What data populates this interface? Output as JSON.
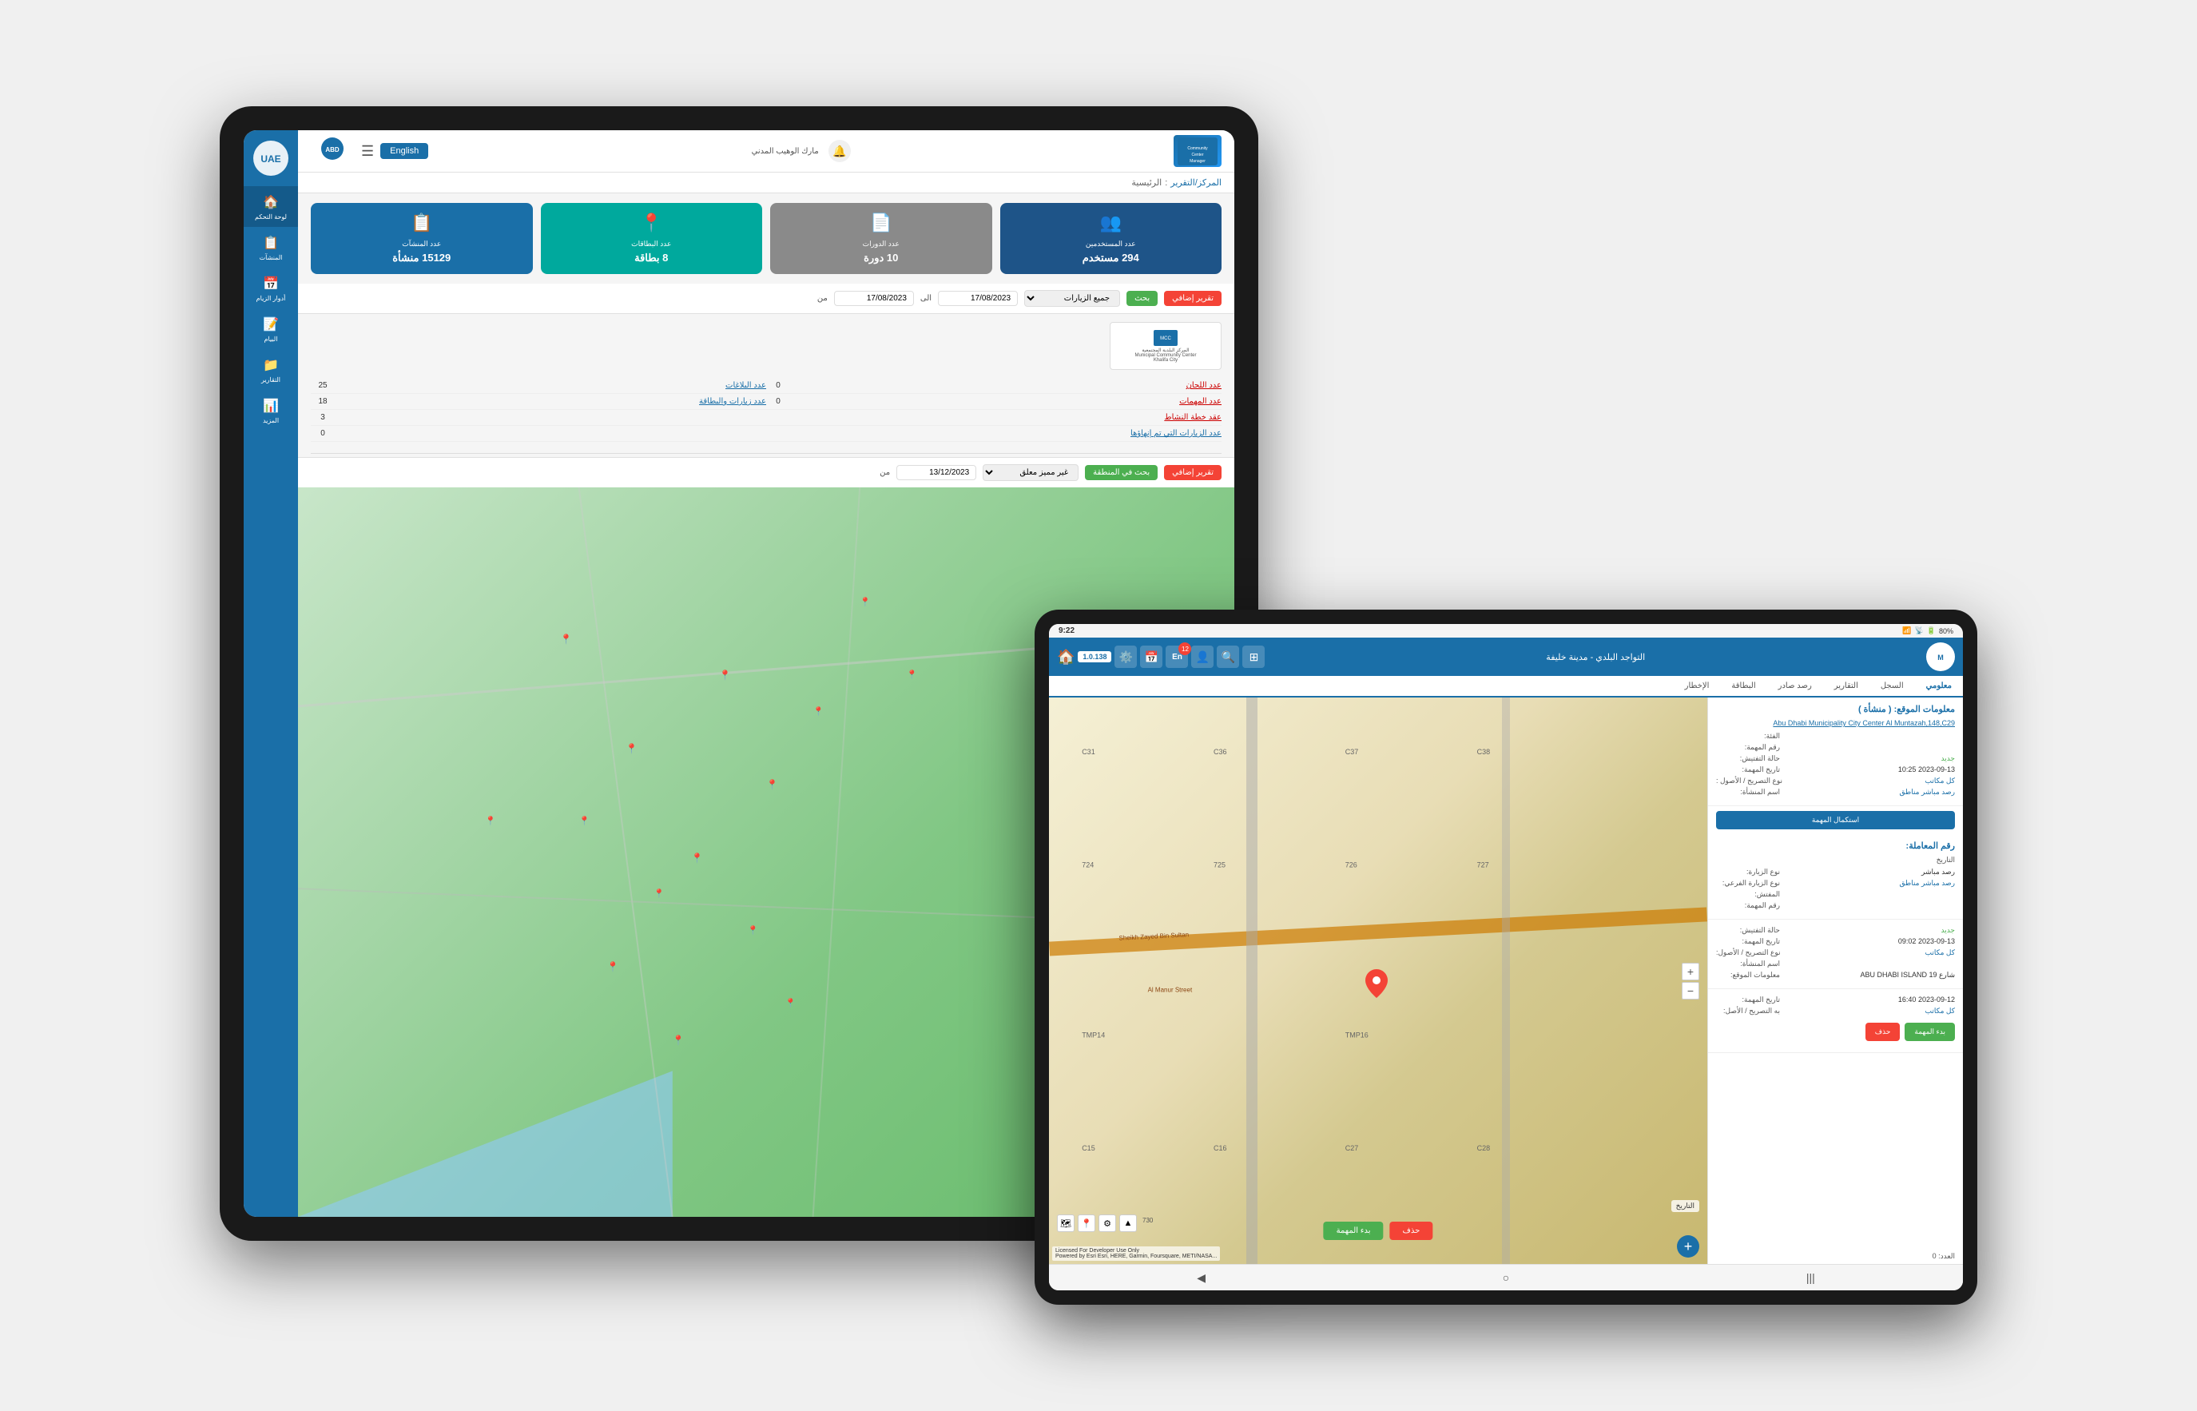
{
  "background": "#f0f2f5",
  "tablet1": {
    "header": {
      "logo_text": "Community Center Manager",
      "user_label": "مارك الوهيب المدني",
      "english_btn": "English",
      "hamburger": "☰"
    },
    "breadcrumb": {
      "home": "الرئيسية",
      "separator": ":",
      "current": "المركز/التقرير"
    },
    "stats": [
      {
        "icon": "📋",
        "label": "عدد المنشآت",
        "value": "15129 منشأة",
        "color": "blue"
      },
      {
        "icon": "📍",
        "label": "عدد البطاقات",
        "value": "8 بطاقة",
        "color": "teal"
      },
      {
        "icon": "📄",
        "label": "عدد الدورات",
        "value": "10 دورة",
        "color": "gray"
      },
      {
        "icon": "👥",
        "label": "عدد المستخدمين",
        "value": "294 مستخدم",
        "color": "dark-blue"
      }
    ],
    "filter": {
      "from_label": "من",
      "to_label": "الى",
      "from_date": "17/08/2023",
      "to_date": "17/08/2023",
      "dropdown_label": "جميع الزيارات",
      "search_btn": "بحث",
      "new_btn": "تقرير إضافي"
    },
    "community_logo": {
      "line1": "المركز البلدية المجتمعية",
      "line2": "Municipal Community Center",
      "line3": "Khalifa City"
    },
    "table": {
      "rows": [
        {
          "label1": "عدد البلاغات",
          "value1": "25",
          "value2": "0",
          "label2": "عدد اللجان"
        },
        {
          "label1": "عدد زيارات والبطاقة",
          "value1": "18",
          "value2": "0",
          "label2": "عدد المهمات"
        },
        {
          "label1": "عقد خطة النشاط",
          "value1": "3",
          "value2": "",
          "label2": ""
        },
        {
          "label1": "عدد الزيارات التي تم إنهاؤها",
          "value1": "0",
          "value2": "",
          "label2": ""
        }
      ]
    },
    "bottom_filter": {
      "from_label": "من",
      "date_input": "13/12/2023",
      "placeholder": "غير مميز معلق",
      "search_btn": "بحث في المنطقة",
      "new_btn": "تقرير إضافي"
    },
    "sidebar": {
      "items": [
        {
          "icon": "🏠",
          "label": "لوحة التحكم"
        },
        {
          "icon": "📋",
          "label": "المنشآت"
        },
        {
          "icon": "📅",
          "label": "أدوار الزيام"
        },
        {
          "icon": "📝",
          "label": "البيام"
        },
        {
          "icon": "📁",
          "label": "التقارير"
        },
        {
          "icon": "📊",
          "label": "المزيد"
        }
      ]
    }
  },
  "tablet2": {
    "status_bar": {
      "time": "9:22",
      "battery": "80%"
    },
    "header": {
      "version": "1.0.138",
      "title": "التواجد البلدي - مدينة خليفة",
      "en_badge": "En",
      "badge_count": "12",
      "home_icon": "🏠"
    },
    "tabs": [
      {
        "label": "معلومي",
        "active": true
      },
      {
        "label": "السجل",
        "active": false
      },
      {
        "label": "التقارير",
        "active": false
      },
      {
        "label": "رصد صادر",
        "active": false
      },
      {
        "label": "البطاقة",
        "active": false
      },
      {
        "label": "الإخطار",
        "active": false
      }
    ],
    "right_panel": {
      "location_info_title": "معلومات الموقع: ( منشأة )",
      "location_link": "Abu Dhabi Municipality City Center Al Muntazah,148,C29",
      "complete_btn": "استكمال المهمة",
      "transaction_title": "رقم المعاملة:",
      "fields_location": [
        {
          "key": "الفئة:",
          "value": ""
        },
        {
          "key": "رقم المهمة:",
          "value": ""
        },
        {
          "key": "حالة التفتيش:",
          "value": "جديد"
        },
        {
          "key": "تاريخ المهمة:",
          "value": "2023-09-13 10:25"
        },
        {
          "key": "نوع التصريح / الأصول:",
          "value": "كل مكاتب",
          "color": "blue"
        },
        {
          "key": "اسم المنشأة:",
          "value": "رصد مباشر مناطق",
          "color": "blue"
        }
      ],
      "transaction_fields": [
        {
          "key": "نوع الزيارة:",
          "value": "رصد مباشر"
        },
        {
          "key": "نوع الزيارة الفرعي:",
          "value": "رصد مباشر مناطق",
          "color": "blue"
        },
        {
          "key": "المفتش:",
          "value": ""
        },
        {
          "key": "رقم المهمة:",
          "value": ""
        },
        {
          "key": "حالة التفتيش:",
          "value": "جديد"
        },
        {
          "key": "تاريخ المهمة:",
          "value": "2023-09-13 09:02"
        },
        {
          "key": "نوع التصريح / الأصول:",
          "value": "كل مكاتب",
          "color": "blue"
        },
        {
          "key": "اسم المنشأة:",
          "value": ""
        },
        {
          "key": "معلومات الموقع:",
          "value": "شارع 19 ABU DHABI ISLAND"
        }
      ],
      "third_transaction_fields": [
        {
          "key": "تاريخ المهمة:",
          "value": "2023-09-12 16:40"
        },
        {
          "key": "به التصريح / الأصل:",
          "value": "كل مكاتب",
          "color": "blue"
        }
      ],
      "action_btns": {
        "delete": "حذف",
        "start": "بدء المهمة"
      },
      "selected_count": "العدد: 0"
    },
    "map": {
      "marker_label": "",
      "attribution": "Licensed For Developer Use Only",
      "powered_by": "Powered by Esri  Esri, HERE, Garmin, Foursquare, METI/NASA...",
      "grid_labels": [
        "C31",
        "C36",
        "C37",
        "C38",
        "724",
        "725",
        "726",
        "727",
        "TMP14",
        "TMP16",
        "C15",
        "C16",
        "C27",
        "C28"
      ]
    },
    "bottom_nav": {
      "back": "◀",
      "home": "○",
      "menu": "|||"
    }
  }
}
